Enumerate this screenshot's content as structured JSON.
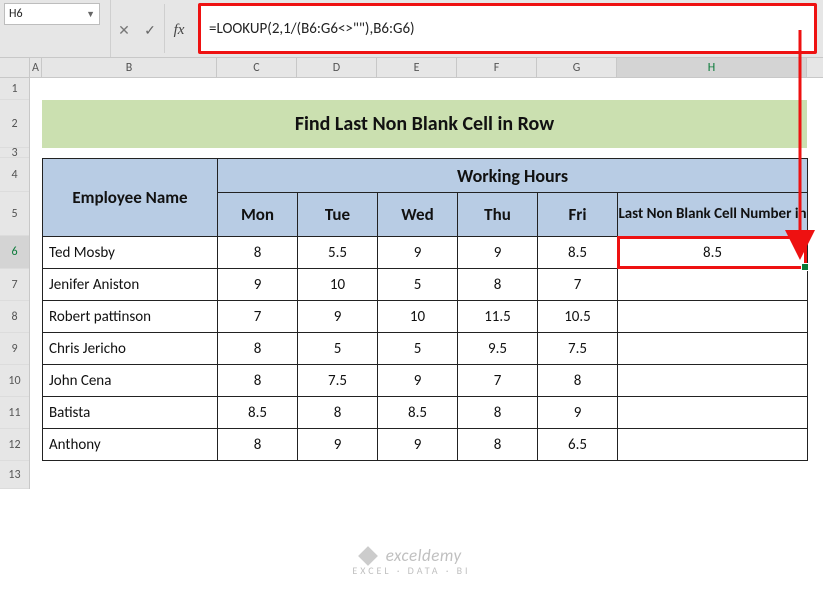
{
  "name_box": "H6",
  "fx_buttons": {
    "cancel": "✕",
    "enter": "✓",
    "fx": "fx"
  },
  "formula_bar": "=LOOKUP(2,1/(B6:G6<>\"\"),B6:G6)",
  "columns": [
    "A",
    "B",
    "C",
    "D",
    "E",
    "F",
    "G",
    "H"
  ],
  "rows": [
    "1",
    "2",
    "3",
    "4",
    "5",
    "6",
    "7",
    "8",
    "9",
    "10",
    "11",
    "12",
    "13"
  ],
  "active_cell": {
    "col": "H",
    "row": "6"
  },
  "title": "Find Last Non Blank Cell in Row",
  "table": {
    "emp_header": "Employee Name",
    "group_header": "Working Hours",
    "day_headers": [
      "Mon",
      "Tue",
      "Wed",
      "Thu",
      "Fri"
    ],
    "last_header": "Last Non Blank Cell Number in",
    "rows": [
      {
        "name": "Ted Mosby",
        "vals": [
          "8",
          "5.5",
          "9",
          "9",
          "8.5"
        ],
        "last": "8.5"
      },
      {
        "name": "Jenifer Aniston",
        "vals": [
          "9",
          "10",
          "5",
          "8",
          "7"
        ],
        "last": ""
      },
      {
        "name": "Robert pattinson",
        "vals": [
          "7",
          "9",
          "10",
          "11.5",
          "10.5"
        ],
        "last": ""
      },
      {
        "name": "Chris Jericho",
        "vals": [
          "8",
          "5",
          "5",
          "9.5",
          "7.5"
        ],
        "last": ""
      },
      {
        "name": "John Cena",
        "vals": [
          "8",
          "7.5",
          "9",
          "7",
          "8"
        ],
        "last": ""
      },
      {
        "name": "Batista",
        "vals": [
          "8.5",
          "8",
          "8.5",
          "8",
          "9"
        ],
        "last": ""
      },
      {
        "name": "Anthony",
        "vals": [
          "8",
          "9",
          "9",
          "8",
          "6.5"
        ],
        "last": ""
      }
    ]
  },
  "watermark": {
    "brand": "exceldemy",
    "tagline": "EXCEL · DATA · BI"
  },
  "chart_data": {
    "type": "table",
    "title": "Find Last Non Blank Cell in Row",
    "columns": [
      "Employee Name",
      "Mon",
      "Tue",
      "Wed",
      "Thu",
      "Fri",
      "Last Non Blank Cell Number in"
    ],
    "rows": [
      [
        "Ted Mosby",
        8,
        5.5,
        9,
        9,
        8.5,
        8.5
      ],
      [
        "Jenifer Aniston",
        9,
        10,
        5,
        8,
        7,
        null
      ],
      [
        "Robert pattinson",
        7,
        9,
        10,
        11.5,
        10.5,
        null
      ],
      [
        "Chris Jericho",
        8,
        5,
        5,
        9.5,
        7.5,
        null
      ],
      [
        "John Cena",
        8,
        7.5,
        9,
        7,
        8,
        null
      ],
      [
        "Batista",
        8.5,
        8,
        8.5,
        8,
        9,
        null
      ],
      [
        "Anthony",
        8,
        9,
        9,
        8,
        6.5,
        null
      ]
    ]
  }
}
